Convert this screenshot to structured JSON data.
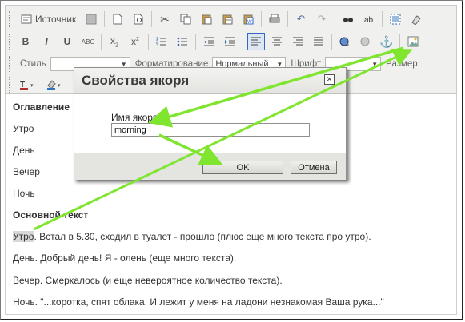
{
  "toolbar": {
    "source_label": "Источник",
    "style_label": "Стиль",
    "format_label": "Форматирование",
    "format_value": "Нормальный",
    "font_label": "Шрифт",
    "size_label": "Размер"
  },
  "content": {
    "toc_heading": "Оглавление",
    "toc_items": [
      "Утро",
      "День",
      "Вечер",
      "Ночь"
    ],
    "main_heading": "Основной текст",
    "para1_word": "Утро",
    "para1_rest": ". Встал в 5.30, сходил в туалет - прошло (плюс еще много текста про утро).",
    "para2": "День. Добрый день! Я - олень (еще много текста).",
    "para3": "Вечер. Смеркалось (и еще невероятное количество текста).",
    "para4": "Ночь. \"...коротка, спят облака. И лежит у меня на ладони незнакомая Ваша рука...\""
  },
  "dialog": {
    "title": "Свойства якоря",
    "field_label": "Имя якоря",
    "field_value": "morning",
    "ok_label": "OK",
    "cancel_label": "Отмена"
  },
  "colors": {
    "annotation_arrow": "#7fe52f",
    "active_button": "#316ac5"
  },
  "icons": [
    "source-icon",
    "new-page-icon",
    "preview-icon",
    "cut-icon",
    "copy-icon",
    "paste-icon",
    "paste-text-icon",
    "paste-word-icon",
    "print-icon",
    "undo-icon",
    "redo-icon",
    "find-icon",
    "replace-icon",
    "select-all-icon",
    "remove-format-icon",
    "bold-icon",
    "italic-icon",
    "underline-icon",
    "strike-icon",
    "subscript-icon",
    "superscript-icon",
    "ordered-list-icon",
    "bullet-list-icon",
    "outdent-icon",
    "indent-icon",
    "align-left-icon",
    "align-center-icon",
    "align-right-icon",
    "justify-icon",
    "link-icon",
    "unlink-icon",
    "anchor-icon",
    "image-icon",
    "text-color-icon",
    "bg-color-icon"
  ]
}
